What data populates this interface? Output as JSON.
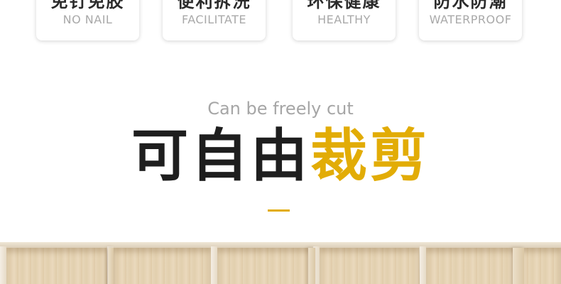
{
  "features": [
    {
      "cn": "免钉免胶",
      "en": "NO NAIL"
    },
    {
      "cn": "便利拆洗",
      "en": "FACILITATE"
    },
    {
      "cn": "环保健康",
      "en": "HEALTHY"
    },
    {
      "cn": "防水防潮",
      "en": "WATERPROOF"
    }
  ],
  "section": {
    "subtitle": "Can be freely cut",
    "headline_dark": "可自由",
    "headline_accent": "裁剪"
  },
  "colors": {
    "accent": "#e2ac06",
    "heading": "#1e1e1e",
    "muted": "#a6a6a6"
  }
}
